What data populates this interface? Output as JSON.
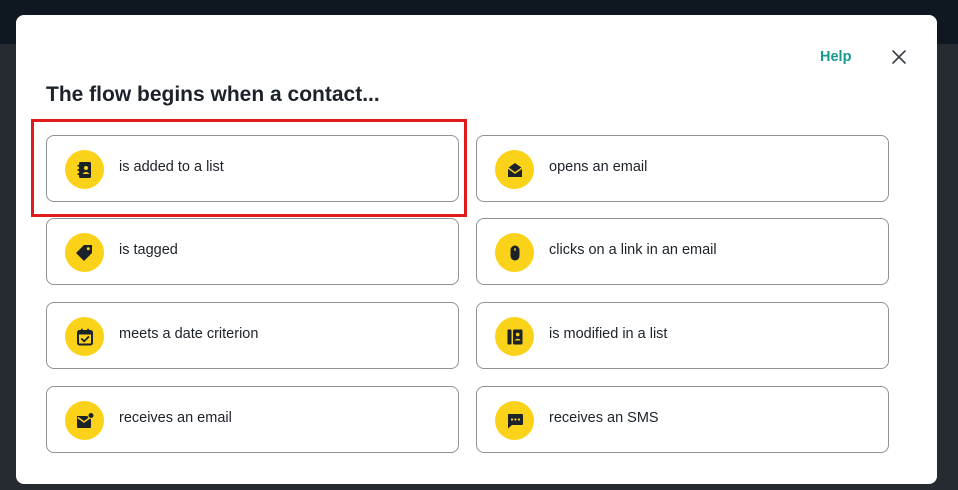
{
  "modal": {
    "title": "The flow begins when a contact...",
    "help_label": "Help",
    "close_icon": "close-icon"
  },
  "options": [
    {
      "label": "is added to a list",
      "icon": "contacts-book-icon"
    },
    {
      "label": "opens an email",
      "icon": "open-envelope-icon"
    },
    {
      "label": "is tagged",
      "icon": "tag-icon"
    },
    {
      "label": "clicks on a link in an email",
      "icon": "mouse-icon"
    },
    {
      "label": "meets a date criterion",
      "icon": "calendar-check-icon"
    },
    {
      "label": "is modified in a list",
      "icon": "contact-card-edit-icon"
    },
    {
      "label": "receives an email",
      "icon": "mail-notification-icon"
    },
    {
      "label": "receives an SMS",
      "icon": "chat-bubble-icon"
    }
  ],
  "colors": {
    "accent": "#fbd21a",
    "help_link": "#13998e",
    "highlight": "#e01a1a",
    "text": "#1c222a",
    "border": "#8e9399"
  }
}
